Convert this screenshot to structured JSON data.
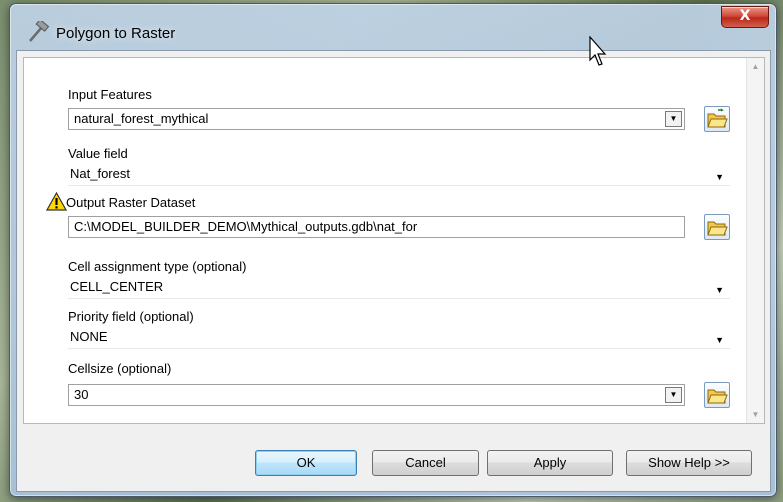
{
  "window": {
    "title": "Polygon to Raster",
    "close_label": "X"
  },
  "fields": {
    "input_features": {
      "label": "Input Features",
      "value": "natural_forest_mythical"
    },
    "value_field": {
      "label": "Value field",
      "value": "Nat_forest"
    },
    "output_raster": {
      "label": "Output Raster Dataset",
      "value": "C:\\MODEL_BUILDER_DEMO\\Mythical_outputs.gdb\\nat_for"
    },
    "cell_assignment": {
      "label": "Cell assignment type (optional)",
      "value": "CELL_CENTER"
    },
    "priority_field": {
      "label": "Priority field (optional)",
      "value": "NONE"
    },
    "cellsize": {
      "label": "Cellsize (optional)",
      "value": "30"
    }
  },
  "buttons": {
    "ok": "OK",
    "cancel": "Cancel",
    "apply": "Apply",
    "show_help": "Show Help >>"
  },
  "icons": {
    "title_icon": "hammer-icon",
    "warning": "warning-icon",
    "browse": "folder-open-icon",
    "cursor": "mouse-pointer-icon"
  },
  "colors": {
    "close_button": "#d2493a",
    "default_button_border": "#3c7fb1",
    "warning_yellow": "#ffd800"
  }
}
